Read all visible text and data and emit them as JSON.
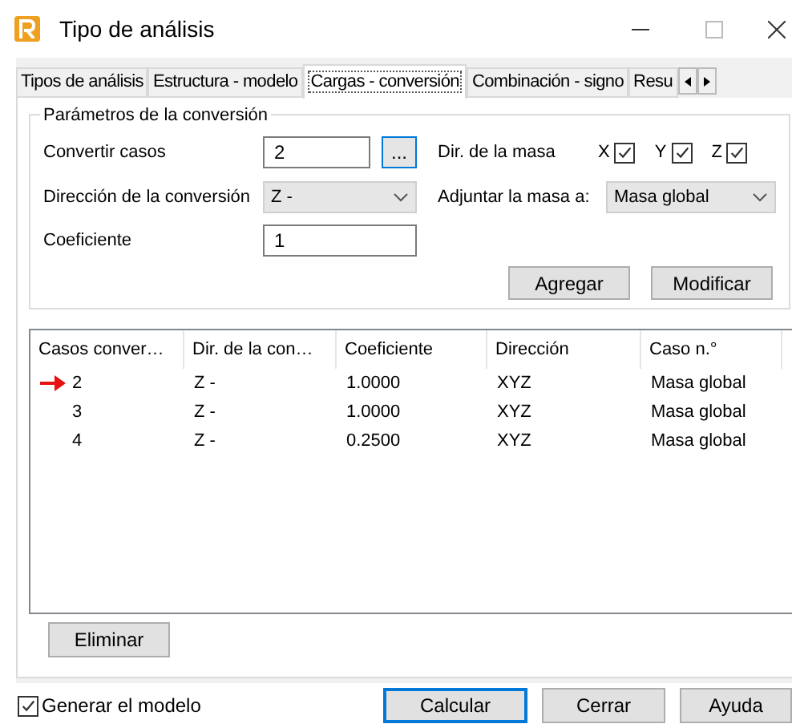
{
  "window": {
    "title": "Tipo de análisis"
  },
  "tabs": [
    {
      "label": "Tipos de análisis",
      "selected": false
    },
    {
      "label": "Estructura - modelo",
      "selected": false
    },
    {
      "label": "Cargas - conversión",
      "selected": true
    },
    {
      "label": "Combinación - signo",
      "selected": false
    },
    {
      "label": "Resu",
      "selected": false
    }
  ],
  "group": {
    "title": "Parámetros de la conversión",
    "convert_cases": {
      "label": "Convertir casos",
      "value": "2",
      "browse": "..."
    },
    "mass_direction": {
      "label": "Dir. de la masa",
      "axes": [
        {
          "label": "X",
          "checked": true
        },
        {
          "label": "Y",
          "checked": true
        },
        {
          "label": "Z",
          "checked": true
        }
      ]
    },
    "conversion_direction": {
      "label": "Dirección de la conversión",
      "value": "Z -"
    },
    "attach_mass": {
      "label": "Adjuntar la masa a:",
      "value": "Masa global"
    },
    "coefficient": {
      "label": "Coeficiente",
      "value": "1"
    },
    "buttons": [
      "Agregar",
      "Modificar"
    ]
  },
  "table": {
    "columns": [
      "Casos conver…",
      "Dir. de la con…",
      "Coeficiente",
      "Dirección",
      "Caso n.°"
    ],
    "rows": [
      {
        "current": true,
        "cells": [
          "2",
          "Z -",
          "1.0000",
          "XYZ",
          "Masa global"
        ]
      },
      {
        "current": false,
        "cells": [
          "3",
          "Z -",
          "1.0000",
          "XYZ",
          "Masa global"
        ]
      },
      {
        "current": false,
        "cells": [
          "4",
          "Z -",
          "0.2500",
          "XYZ",
          "Masa global"
        ]
      }
    ]
  },
  "delete_button": "Eliminar",
  "generate_model": {
    "label": "Generar el modelo",
    "checked": true
  },
  "buttons": [
    {
      "label": "Calcular",
      "default": true
    },
    {
      "label": "Cerrar",
      "default": false
    },
    {
      "label": "Ayuda",
      "default": false
    }
  ]
}
